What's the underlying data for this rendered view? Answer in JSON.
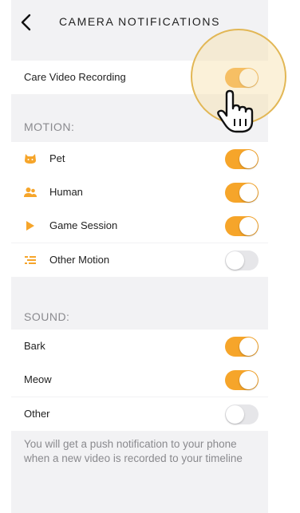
{
  "header": {
    "title": "CAMERA NOTIFICATIONS",
    "back_icon": "chevron-left-icon"
  },
  "care": {
    "label": "Care Video Recording",
    "enabled": true
  },
  "motion": {
    "header": "MOTION:",
    "items": [
      {
        "label": "Pet",
        "icon": "cat-face-icon",
        "enabled": true
      },
      {
        "label": "Human",
        "icon": "people-icon",
        "enabled": true
      },
      {
        "label": "Game Session",
        "icon": "play-icon",
        "enabled": true
      },
      {
        "label": "Other Motion",
        "icon": "motion-lines-icon",
        "enabled": false
      }
    ]
  },
  "sound": {
    "header": "SOUND:",
    "items": [
      {
        "label": "Bark",
        "enabled": true
      },
      {
        "label": "Meow",
        "enabled": true
      },
      {
        "label": "Other",
        "enabled": false
      }
    ]
  },
  "footer": {
    "note": "You will get a push notification to your phone when a new video is recorded to your timeline"
  },
  "colors": {
    "accent": "#f6a52a",
    "toggle_off": "#e6e6e9",
    "background": "#f2f2f4",
    "highlight": "#e2b755"
  },
  "pointer": {
    "icon": "hand-pointer-icon"
  }
}
